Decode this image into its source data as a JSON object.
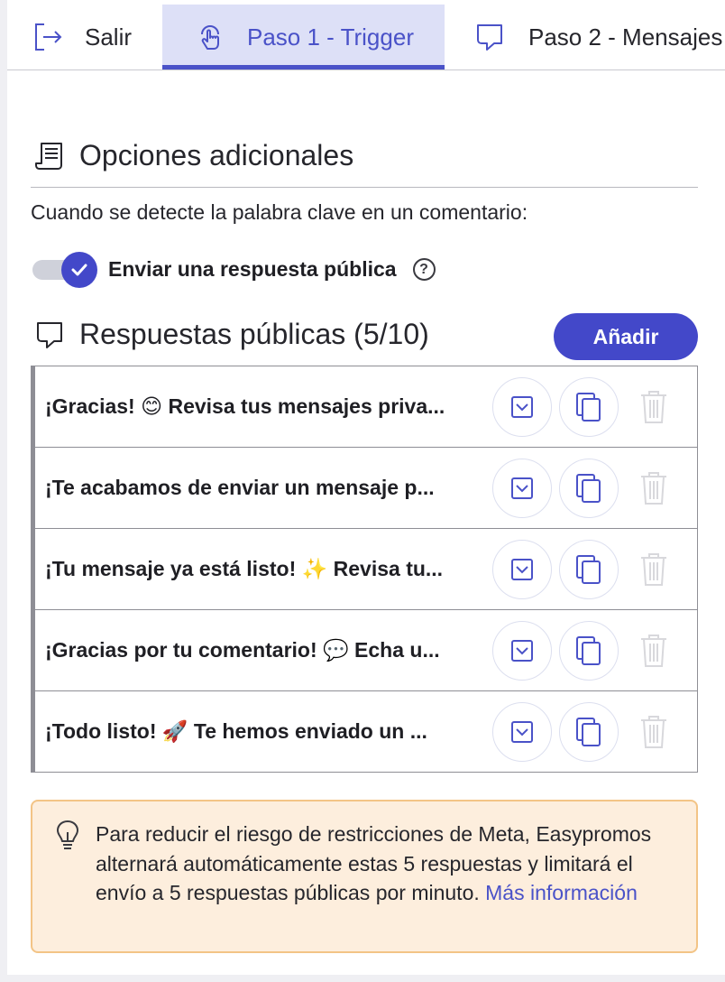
{
  "tabs": [
    {
      "label": "Salir",
      "icon": "exit-icon"
    },
    {
      "label": "Paso 1 - Trigger",
      "icon": "touch-icon",
      "active": true
    },
    {
      "label": "Paso 2 - Mensajes",
      "icon": "chat-bubble-icon"
    }
  ],
  "additional": {
    "title": "Opciones adicionales",
    "description": "Cuando se detecte la palabra clave en un comentario:",
    "toggle_label": "Enviar una respuesta pública",
    "toggle_on": true,
    "help_glyph": "?"
  },
  "responses": {
    "title": "Respuestas públicas (5/10)",
    "add_label": "Añadir",
    "items": [
      "¡Gracias! 😊 Revisa tus mensajes priva...",
      "¡Te acabamos de enviar un mensaje p...",
      "¡Tu mensaje ya está listo! ✨ Revisa tu...",
      "¡Gracias por tu comentario! 💬 Echa u...",
      "¡Todo listo! 🚀 Te hemos enviado un ..."
    ]
  },
  "tip": {
    "text": "Para reducir el riesgo de restricciones de Meta, Easypromos alternará automáticamente estas 5 respuestas y limitará el envío a 5 respuestas públicas por minuto.",
    "link": "Más información"
  },
  "colors": {
    "accent": "#4348c9",
    "tab_active_bg": "#dde0f7",
    "tip_bg": "#fdeedd",
    "tip_border": "#f3c486"
  }
}
